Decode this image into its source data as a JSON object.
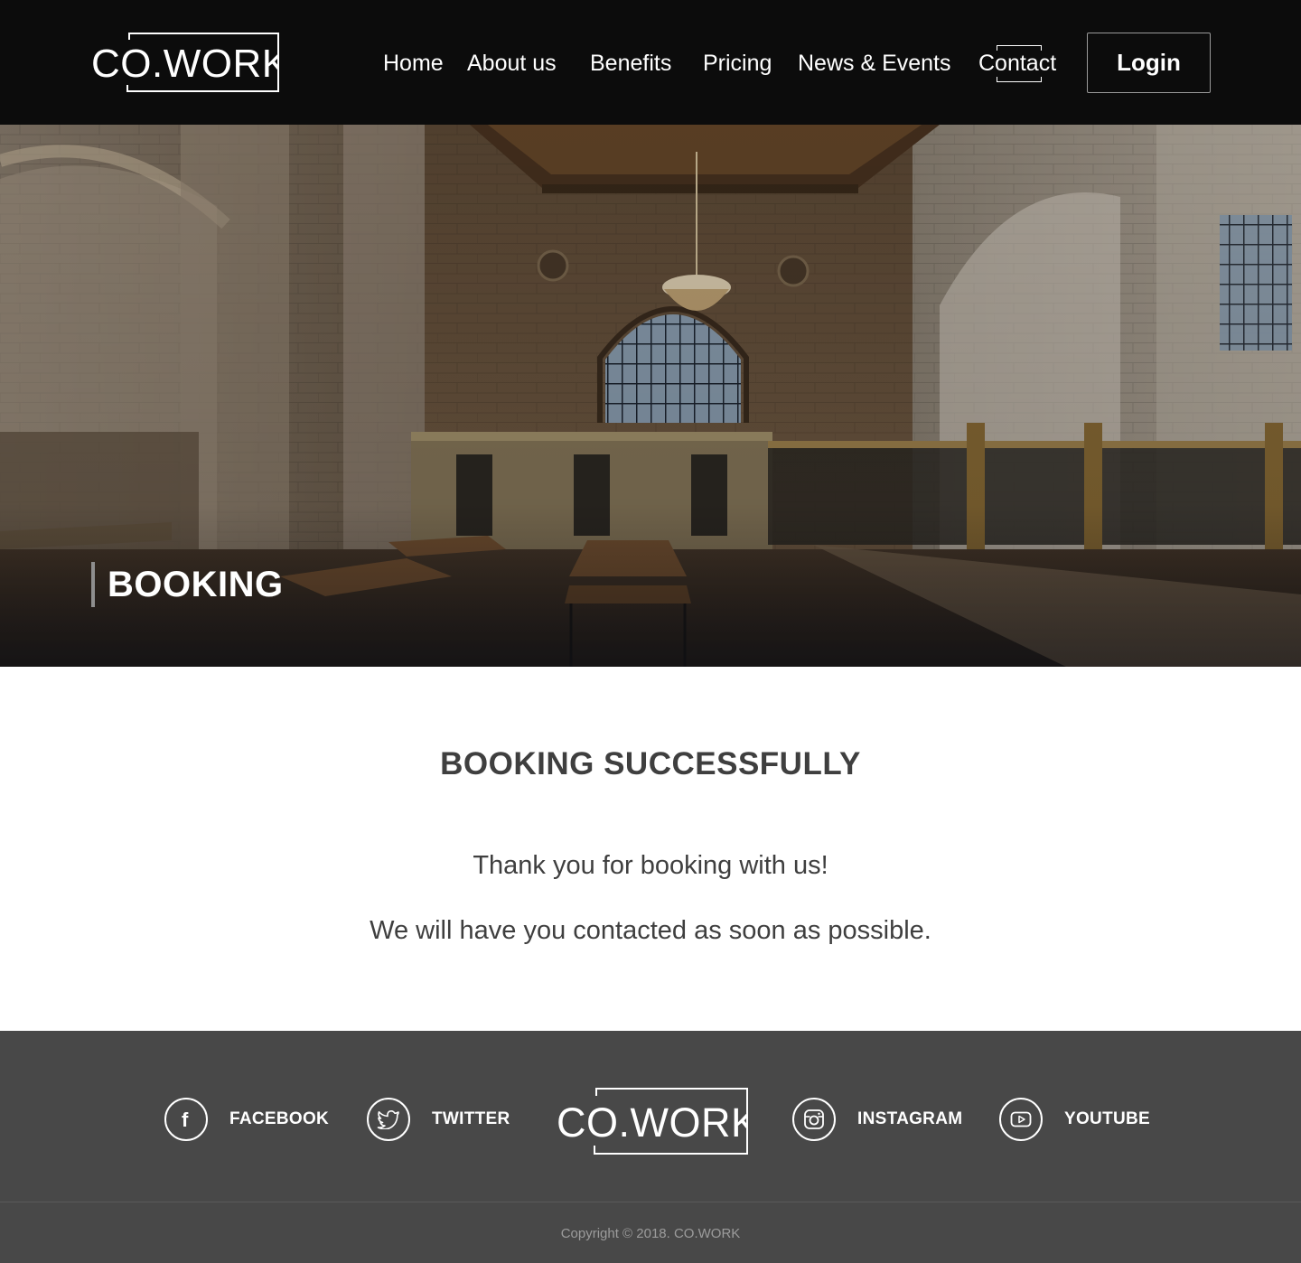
{
  "brand": {
    "logo_text": "CO.WORK"
  },
  "nav": {
    "items": [
      {
        "label": "Home"
      },
      {
        "label": "About us"
      },
      {
        "label": "Benefits"
      },
      {
        "label": "Pricing"
      },
      {
        "label": "News & Events"
      },
      {
        "label": "Contact",
        "active": true
      }
    ],
    "login_label": "Login"
  },
  "hero": {
    "title": "BOOKING",
    "image": "coworking hall in historic bank interior"
  },
  "main": {
    "title": "BOOKING SUCCESSFULLY",
    "message_1": "Thank you for booking with us!",
    "message_2": "We will have you contacted as soon as possible."
  },
  "footer": {
    "social": [
      {
        "label": "FACEBOOK",
        "icon": "facebook-icon"
      },
      {
        "label": "TWITTER",
        "icon": "twitter-icon"
      },
      {
        "label": "INSTAGRAM",
        "icon": "instagram-icon"
      },
      {
        "label": "YOUTUBE",
        "icon": "youtube-icon"
      }
    ],
    "logo_text": "CO.WORK",
    "copyright": "Copyright © 2018. CO.WORK"
  },
  "colors": {
    "header_bg": "#0c0c0c",
    "footer_bg": "#484848",
    "text": "#404040",
    "white": "#ffffff"
  }
}
